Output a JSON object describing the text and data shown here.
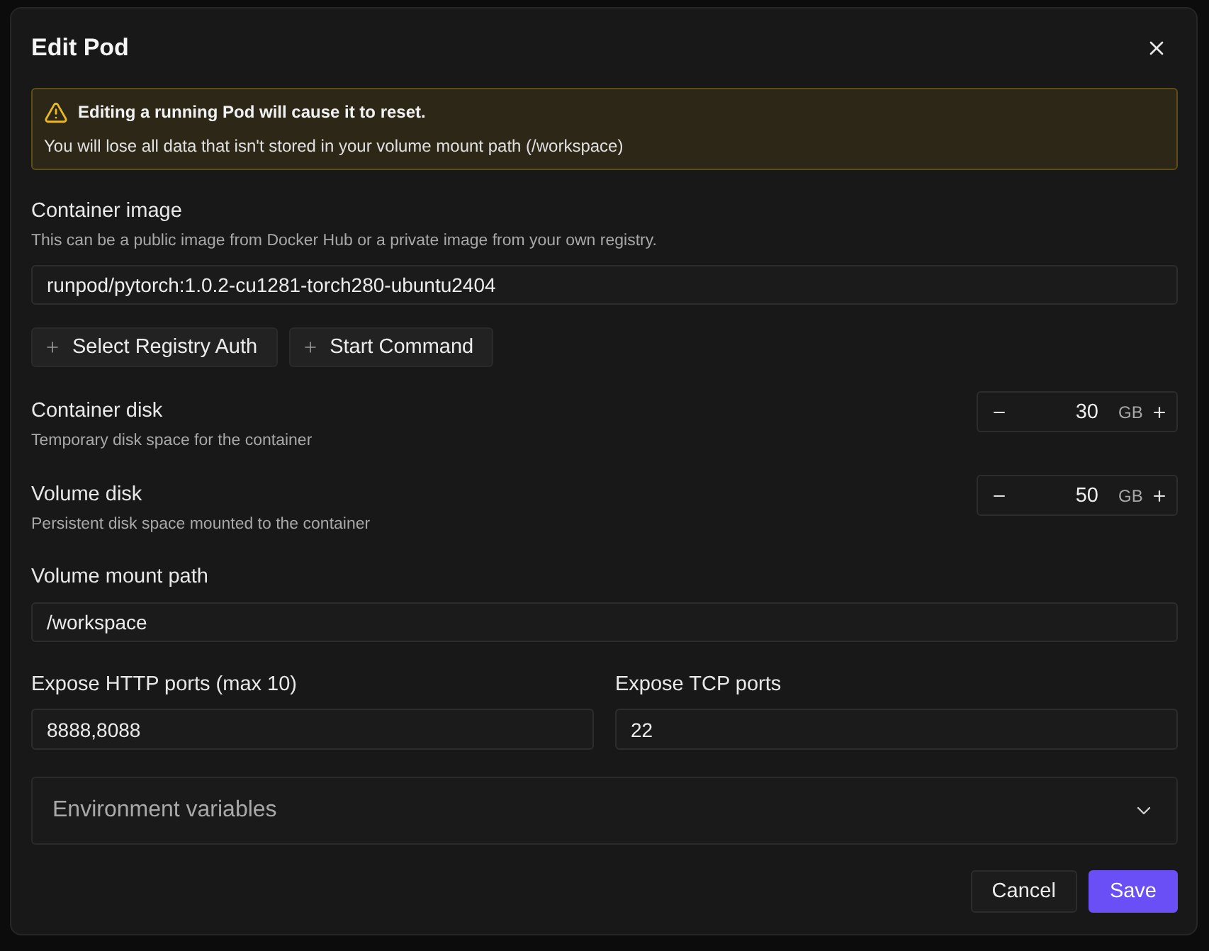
{
  "dialog": {
    "title": "Edit Pod"
  },
  "warning": {
    "title": "Editing a running Pod will cause it to reset.",
    "message": "You will lose all data that isn't stored in your volume mount path (/workspace)"
  },
  "container_image": {
    "label": "Container image",
    "help": "This can be a public image from Docker Hub or a private image from your own registry.",
    "value": "runpod/pytorch:1.0.2-cu1281-torch280-ubuntu2404"
  },
  "image_options": [
    {
      "label": "Select Registry Auth"
    },
    {
      "label": "Start Command"
    }
  ],
  "disks": [
    {
      "label": "Container disk",
      "help": "Temporary disk space for the container",
      "value": "30",
      "unit": "GB"
    },
    {
      "label": "Volume disk",
      "help": "Persistent disk space mounted to the container",
      "value": "50",
      "unit": "GB"
    }
  ],
  "mount_path": {
    "label": "Volume mount path",
    "value": "/workspace"
  },
  "ports": [
    {
      "label": "Expose HTTP ports (max 10)",
      "value": "8888,8088"
    },
    {
      "label": "Expose TCP ports",
      "value": "22"
    }
  ],
  "environment": {
    "label": "Environment variables",
    "expanded": false
  },
  "actions": [
    {
      "label": "Cancel",
      "kind": "secondary"
    },
    {
      "label": "Save",
      "kind": "primary"
    }
  ]
}
